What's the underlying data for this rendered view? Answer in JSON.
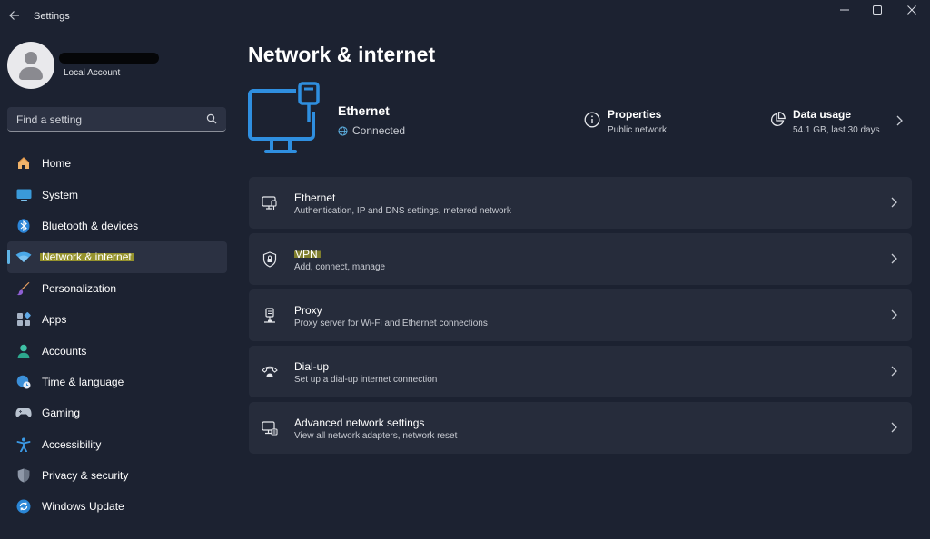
{
  "window": {
    "title": "Settings"
  },
  "account": {
    "type": "Local Account"
  },
  "search": {
    "placeholder": "Find a setting"
  },
  "sidebar": {
    "items": [
      {
        "label": "Home",
        "icon": "home-icon"
      },
      {
        "label": "System",
        "icon": "monitor-icon"
      },
      {
        "label": "Bluetooth & devices",
        "icon": "bluetooth-icon"
      },
      {
        "label": "Network & internet",
        "icon": "wifi-icon",
        "active": true
      },
      {
        "label": "Personalization",
        "icon": "brush-icon"
      },
      {
        "label": "Apps",
        "icon": "apps-icon"
      },
      {
        "label": "Accounts",
        "icon": "person-icon"
      },
      {
        "label": "Time & language",
        "icon": "globe-clock-icon"
      },
      {
        "label": "Gaming",
        "icon": "controller-icon"
      },
      {
        "label": "Accessibility",
        "icon": "accessibility-icon"
      },
      {
        "label": "Privacy & security",
        "icon": "shield-icon"
      },
      {
        "label": "Windows Update",
        "icon": "update-icon"
      }
    ]
  },
  "main": {
    "title": "Network & internet",
    "connection": {
      "name": "Ethernet",
      "status": "Connected",
      "properties_title": "Properties",
      "properties_sub": "Public network",
      "usage_title": "Data usage",
      "usage_sub": "54.1 GB, last 30 days"
    },
    "cards": [
      {
        "title": "Ethernet",
        "sub": "Authentication, IP and DNS settings, metered network",
        "icon": "ethernet-icon"
      },
      {
        "title": "VPN",
        "sub": "Add, connect, manage",
        "icon": "vpn-shield-icon"
      },
      {
        "title": "Proxy",
        "sub": "Proxy server for Wi-Fi and Ethernet connections",
        "icon": "proxy-icon"
      },
      {
        "title": "Dial-up",
        "sub": "Set up a dial-up internet connection",
        "icon": "dialup-icon"
      },
      {
        "title": "Advanced network settings",
        "sub": "View all network adapters, network reset",
        "icon": "advanced-network-icon"
      }
    ]
  },
  "colors": {
    "background": "#1c2231",
    "card": "#262c3b",
    "accent": "#5fb4e6",
    "highlight": "#ece21c"
  }
}
